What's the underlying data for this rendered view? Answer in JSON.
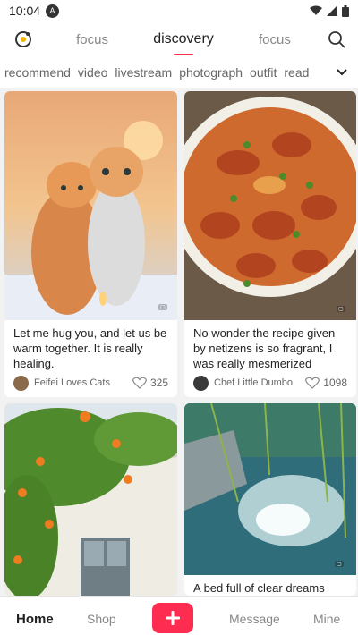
{
  "status": {
    "time": "10:04",
    "badge": "A"
  },
  "header": {
    "tabs": [
      "focus",
      "discovery",
      "focus"
    ],
    "active_tab_index": 1
  },
  "categories": [
    "recommend",
    "video",
    "livestream",
    "photograph",
    "outfit",
    "read"
  ],
  "feed": [
    {
      "title": "Let me hug you, and let us be warm together. It is really healing.",
      "author": "Feifei Loves Cats",
      "likes": "325"
    },
    {
      "title": "No wonder the recipe given by netizens is so fragrant, I was really mesmerized",
      "author": "Chef Little Dumbo",
      "likes": "1098"
    },
    {
      "title": "",
      "author": "",
      "likes": ""
    },
    {
      "title": "A bed full of clear dreams",
      "author": "",
      "likes": ""
    }
  ],
  "bottom_nav": {
    "home": "Home",
    "shop": "Shop",
    "message": "Message",
    "mine": "Mine"
  },
  "colors": {
    "accent": "#ff2c52"
  }
}
